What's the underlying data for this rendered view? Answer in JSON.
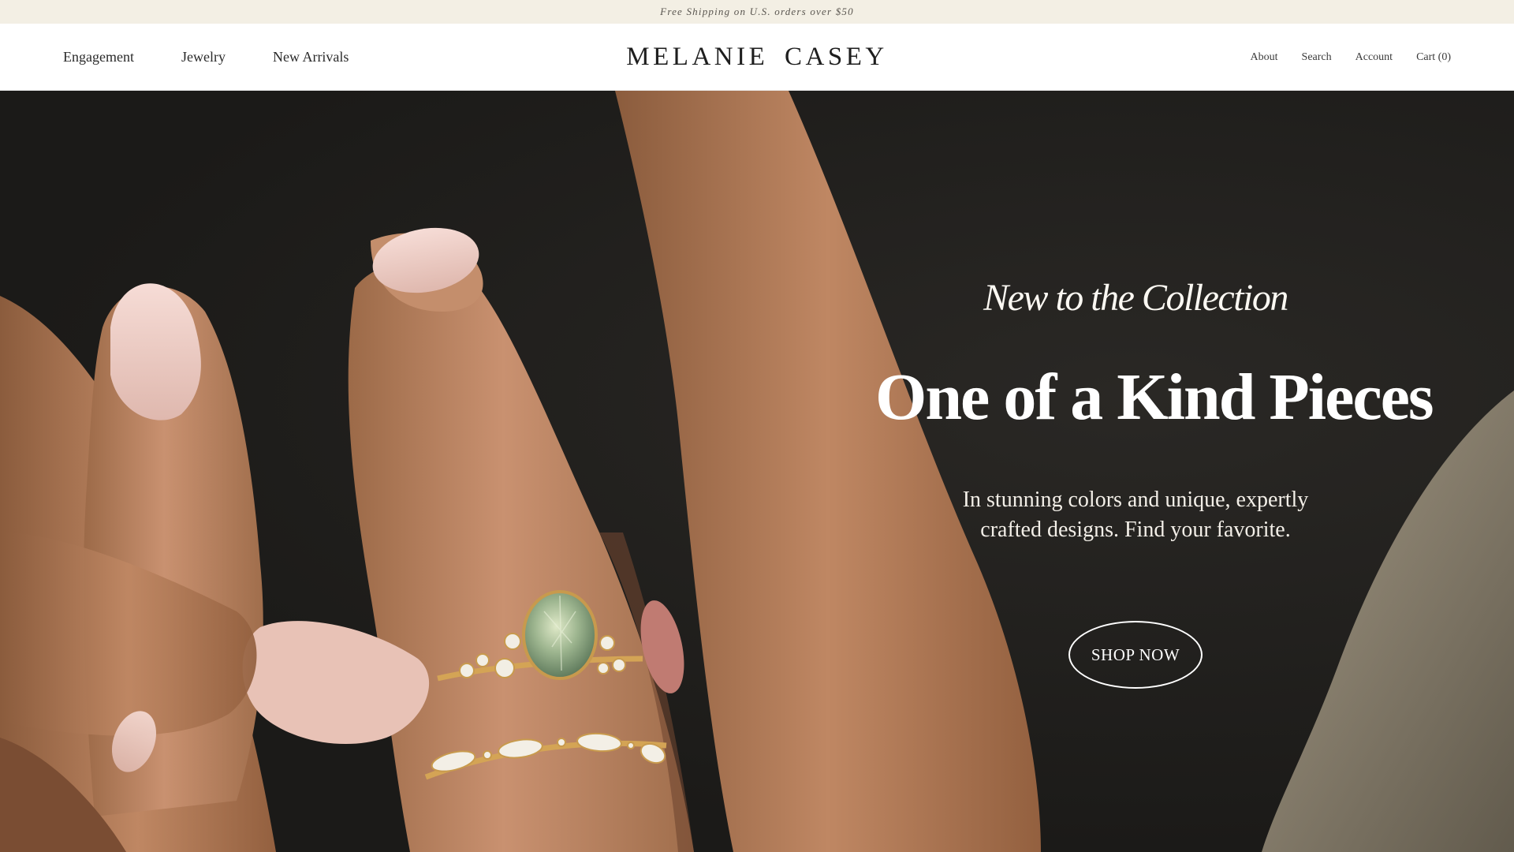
{
  "announcement": {
    "text": "Free Shipping on U.S. orders over $50"
  },
  "header": {
    "logo": "MELANIE CASEY",
    "nav_left": [
      {
        "label": "Engagement"
      },
      {
        "label": "Jewelry"
      },
      {
        "label": "New Arrivals"
      }
    ],
    "nav_right": [
      {
        "label": "About"
      },
      {
        "label": "Search"
      },
      {
        "label": "Account"
      },
      {
        "label": "Cart (0)"
      }
    ]
  },
  "hero": {
    "eyebrow": "New to the Collection",
    "headline": "One of a Kind Pieces",
    "subtext": "In stunning colors and unique, expertly crafted designs. Find your favorite.",
    "cta": "SHOP NOW",
    "image": "hand-with-green-sapphire-ring-photo"
  },
  "colors": {
    "announcement_bg": "#f3efe4",
    "header_bg": "#ffffff",
    "hero_bg": "#1c1b19",
    "skin": "#c08a62",
    "gold": "#d4a455",
    "gem": "#9db58f"
  }
}
